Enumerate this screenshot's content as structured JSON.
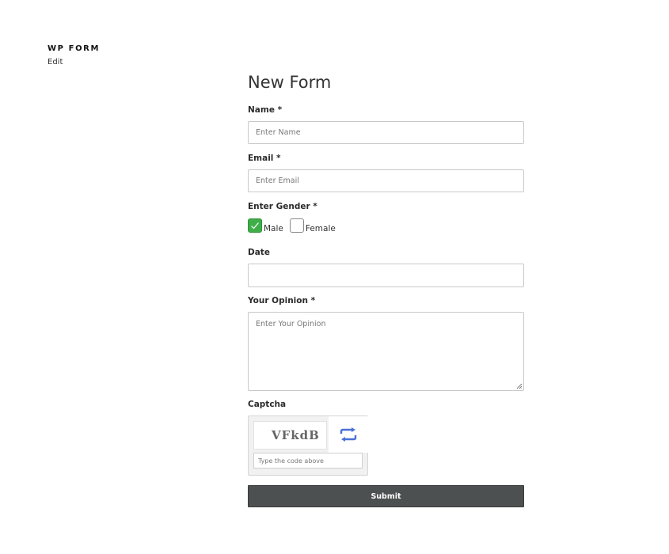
{
  "header": {
    "site_title": "WP FORM",
    "edit_link": "Edit"
  },
  "form": {
    "title": "New Form",
    "fields": {
      "name": {
        "label": "Name *",
        "placeholder": "Enter Name",
        "value": ""
      },
      "email": {
        "label": "Email *",
        "placeholder": "Enter Email",
        "value": ""
      },
      "gender": {
        "label": "Enter Gender *",
        "options": [
          {
            "label": "Male",
            "checked": true
          },
          {
            "label": "Female",
            "checked": false
          }
        ]
      },
      "date": {
        "label": "Date",
        "value": ""
      },
      "opinion": {
        "label": "Your Opinion *",
        "placeholder": "Enter Your Opinion",
        "value": ""
      },
      "captcha": {
        "label": "Captcha",
        "code": "VFkdB",
        "input_placeholder": "Type the code above",
        "refresh_icon": "refresh-arrows-icon"
      }
    },
    "submit_label": "Submit"
  },
  "colors": {
    "checkbox_checked": "#3fae49",
    "submit_background": "#4d5050",
    "refresh_icon": "#4a6fd8"
  }
}
